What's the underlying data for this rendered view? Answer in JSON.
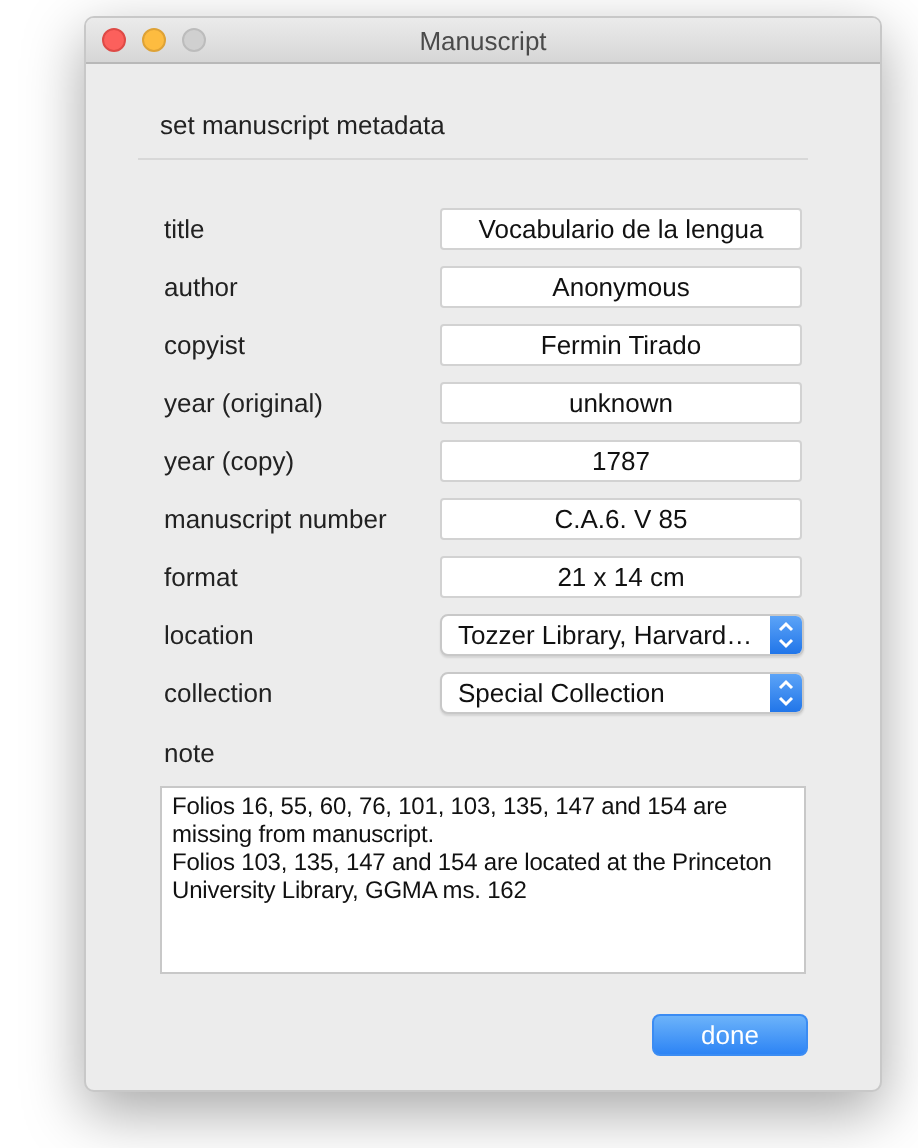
{
  "window": {
    "title": "Manuscript"
  },
  "heading": "set manuscript metadata",
  "fields": [
    {
      "label": "title",
      "kind": "text",
      "value": "Vocabulario de la lengua"
    },
    {
      "label": "author",
      "kind": "text",
      "value": "Anonymous"
    },
    {
      "label": "copyist",
      "kind": "text",
      "value": "Fermin Tirado"
    },
    {
      "label": "year (original)",
      "kind": "text",
      "value": "unknown"
    },
    {
      "label": "year (copy)",
      "kind": "text",
      "value": "1787"
    },
    {
      "label": "manuscript number",
      "kind": "text",
      "value": "C.A.6. V 85"
    },
    {
      "label": "format",
      "kind": "text",
      "value": "21 x 14 cm"
    },
    {
      "label": "location",
      "kind": "popup",
      "value": "Tozzer Library, Harvard…"
    },
    {
      "label": "collection",
      "kind": "popup",
      "value": "Special Collection"
    }
  ],
  "note": {
    "label": "note",
    "paragraphs": [
      "Folios 16, 55, 60, 76, 101, 103, 135, 147 and 154 are missing from manuscript.",
      "Folios 103, 135, 147 and 154 are located at the Princeton University Library, GGMA ms. 162"
    ]
  },
  "buttons": [
    "done"
  ]
}
